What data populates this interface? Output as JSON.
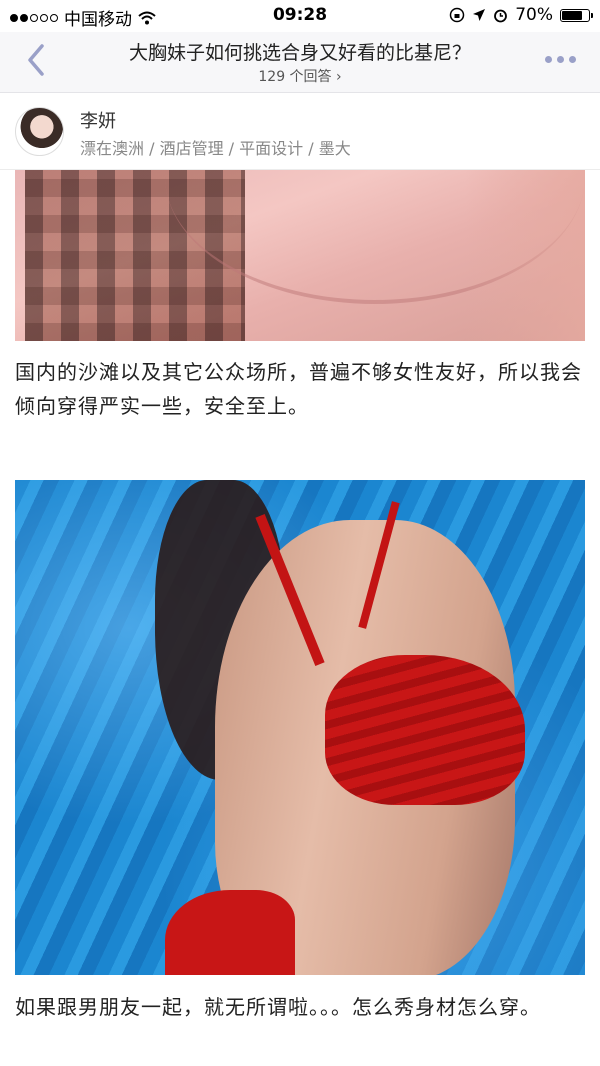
{
  "status_bar": {
    "carrier": "中国移动",
    "time": "09:28",
    "battery": "70%",
    "battery_level": 0.7
  },
  "nav": {
    "title": "大胸妹子如何挑选合身又好看的比基尼？",
    "answers": "129 个回答 ›"
  },
  "author": {
    "name": "李妍",
    "bio": "漂在澳洲 / 酒店管理 / 平面设计 / 墨大"
  },
  "content": {
    "paragraph_1": "国内的沙滩以及其它公众场所，普遍不够女性友好，所以我会倾向穿得严实一些，安全至上。",
    "paragraph_2": "如果跟男朋友一起，就无所谓啦。。。怎么秀身材怎么穿。"
  }
}
